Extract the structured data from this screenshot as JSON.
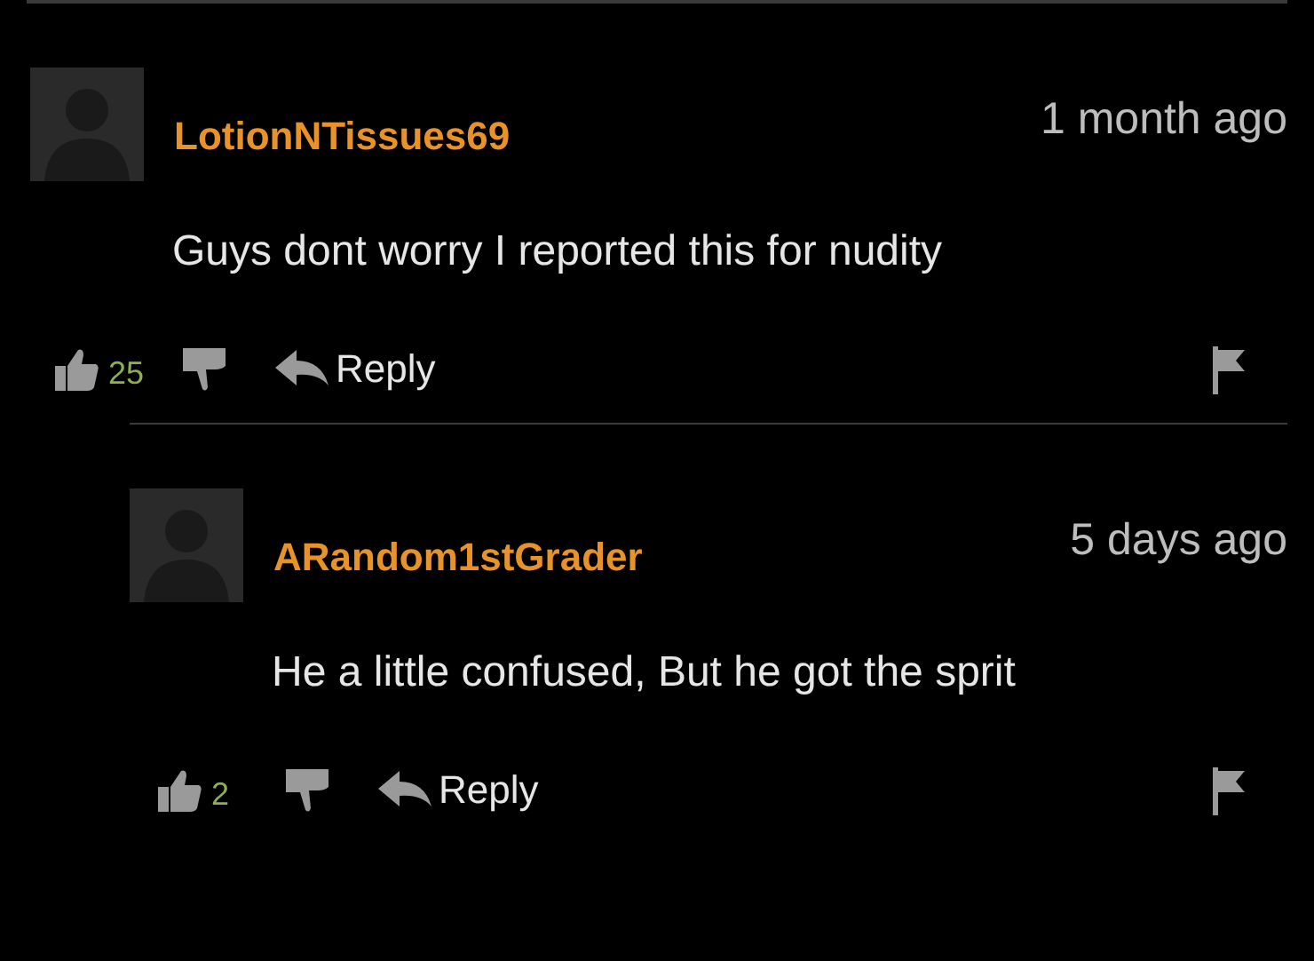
{
  "comments": [
    {
      "author": "LotionNTissues69",
      "time": "1 month ago",
      "text": "Guys dont worry I reported this for nudity",
      "likes": "25",
      "reply": "Reply",
      "children": [
        {
          "author": "ARandom1stGrader",
          "time": "5 days ago",
          "text": "He a little confused, But he got the sprit",
          "likes": "2",
          "reply": "Reply"
        }
      ]
    }
  ]
}
